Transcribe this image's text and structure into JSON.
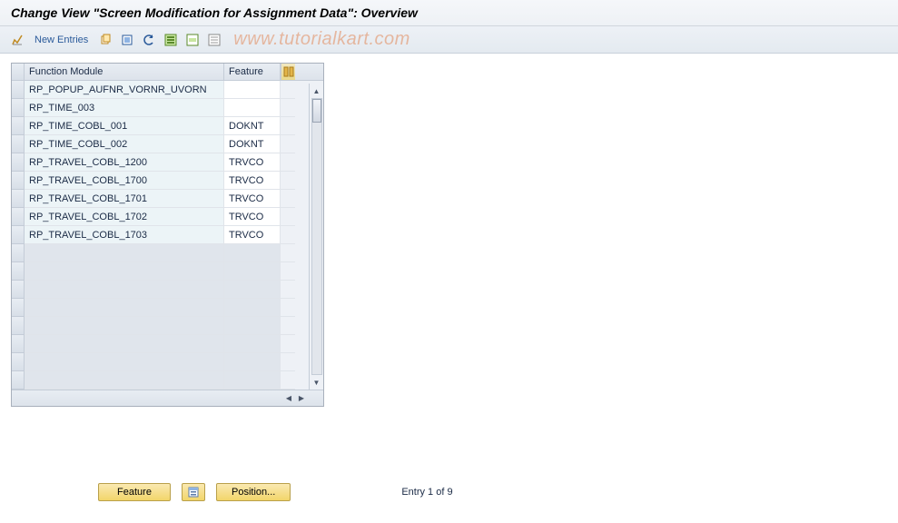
{
  "title": "Change View \"Screen Modification for Assignment Data\": Overview",
  "toolbar": {
    "new_entries": "New Entries"
  },
  "watermark": "www.tutorialkart.com",
  "grid": {
    "columns": {
      "fm": "Function Module",
      "ft": "Feature"
    },
    "rows": [
      {
        "fm": "RP_POPUP_AUFNR_VORNR_UVORN",
        "ft": ""
      },
      {
        "fm": "RP_TIME_003",
        "ft": ""
      },
      {
        "fm": "RP_TIME_COBL_001",
        "ft": "DOKNT"
      },
      {
        "fm": "RP_TIME_COBL_002",
        "ft": "DOKNT"
      },
      {
        "fm": "RP_TRAVEL_COBL_1200",
        "ft": "TRVCO"
      },
      {
        "fm": "RP_TRAVEL_COBL_1700",
        "ft": "TRVCO"
      },
      {
        "fm": "RP_TRAVEL_COBL_1701",
        "ft": "TRVCO"
      },
      {
        "fm": "RP_TRAVEL_COBL_1702",
        "ft": "TRVCO"
      },
      {
        "fm": "RP_TRAVEL_COBL_1703",
        "ft": "TRVCO"
      }
    ],
    "empty_rows": 8
  },
  "footer": {
    "feature_btn": "Feature",
    "position_btn": "Position...",
    "entry_status": "Entry 1 of 9"
  }
}
